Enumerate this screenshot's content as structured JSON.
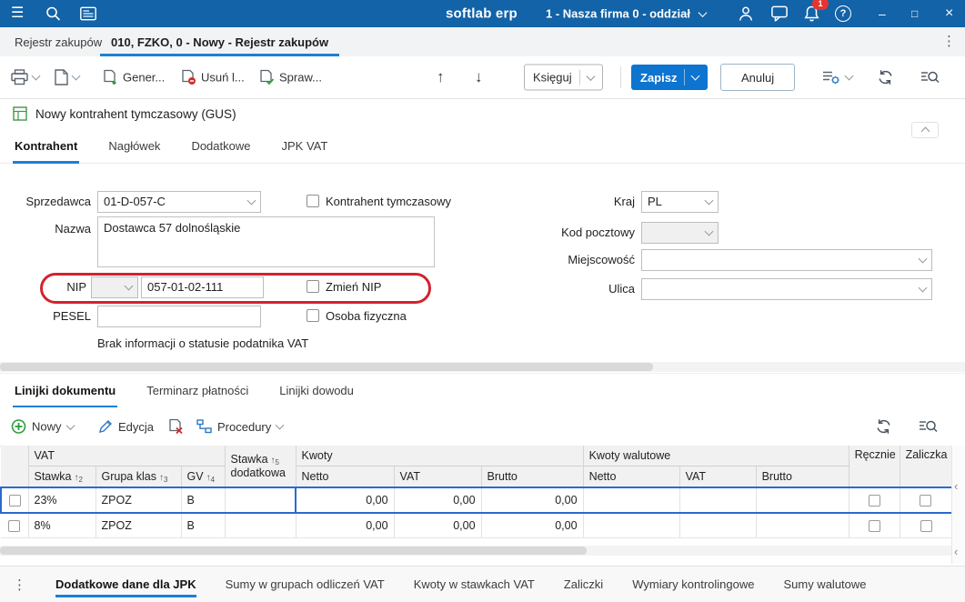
{
  "icons": {
    "hamburger": "☰",
    "dots_vertical": "⋮",
    "minimize": "–",
    "maximize": "□",
    "close": "×",
    "arrow_up": "↑",
    "arrow_down": "↓",
    "sort_asc": "↑",
    "chevron_left": "‹",
    "question": "?"
  },
  "topbar": {
    "brand": "softlab erp",
    "company": "1 - Nasza firma 0 - oddział",
    "notification_badge": "1"
  },
  "tabstrip": {
    "background_tab": "Rejestr zakupów",
    "active_tab": "010, FZKO, 0 - Nowy - Rejestr zakupów"
  },
  "toolbar": {
    "generate": "Gener...",
    "delete": "Usuń l...",
    "check": "Spraw...",
    "ksieguj": "Księguj",
    "zapisz": "Zapisz",
    "anuluj": "Anuluj"
  },
  "panel": {
    "title": "Nowy kontrahent tymczasowy (GUS)"
  },
  "form_tabs": {
    "kontrahent": "Kontrahent",
    "naglowek": "Nagłówek",
    "dodatkowe": "Dodatkowe",
    "jpk_vat": "JPK VAT"
  },
  "form": {
    "sprzedawca": {
      "label": "Sprzedawca",
      "value": "01-D-057-C"
    },
    "kontrahent_tymczasowy": "Kontrahent tymczasowy",
    "kraj": {
      "label": "Kraj",
      "value": "PL"
    },
    "nazwa": {
      "label": "Nazwa",
      "value": "Dostawca 57 dolnośląskie"
    },
    "kod_pocztowy": {
      "label": "Kod pocztowy",
      "value": ""
    },
    "miejscowosc": {
      "label": "Miejscowość",
      "value": ""
    },
    "nip": {
      "label": "NIP",
      "value": "057-01-02-111"
    },
    "zmien_nip": "Zmień NIP",
    "ulica": {
      "label": "Ulica",
      "value": ""
    },
    "pesel": {
      "label": "PESEL",
      "value": ""
    },
    "osoba_fizyczna": "Osoba fizyczna",
    "vat_status": "Brak informacji o statusie podatnika VAT"
  },
  "detail_tabs": {
    "linijki_dokumentu": "Linijki dokumentu",
    "terminarz": "Terminarz płatności",
    "linijki_dowodu": "Linijki dowodu"
  },
  "detail_toolbar": {
    "nowy": "Nowy",
    "edycja": "Edycja",
    "procedury": "Procedury"
  },
  "grid": {
    "groups": {
      "vat": "VAT",
      "kwoty": "Kwoty",
      "kwoty_walutowe": "Kwoty walutowe"
    },
    "columns": {
      "stawka": {
        "label": "Stawka",
        "sort": "2"
      },
      "grupa": {
        "label": "Grupa klas",
        "sort": "3"
      },
      "gv": {
        "label": "GV",
        "sort": "4"
      },
      "stawka_dodatkowa": {
        "label_top": "Stawka",
        "sort": "5",
        "label_bottom": "dodatkowa"
      },
      "netto": "Netto",
      "vat": "VAT",
      "brutto": "Brutto",
      "netto_wal": "Netto",
      "vat_wal": "VAT",
      "brutto_wal": "Brutto",
      "recznie": "Ręcznie",
      "zaliczka": "Zaliczka"
    },
    "rows": [
      {
        "stawka": "23%",
        "grupa": "ZPOZ",
        "gv": "B",
        "stawka_dodatkowa": "",
        "netto": "0,00",
        "vat": "0,00",
        "brutto": "0,00",
        "netto_wal": "",
        "vat_wal": "",
        "brutto_wal": ""
      },
      {
        "stawka": "8%",
        "grupa": "ZPOZ",
        "gv": "B",
        "stawka_dodatkowa": "",
        "netto": "0,00",
        "vat": "0,00",
        "brutto": "0,00",
        "netto_wal": "",
        "vat_wal": "",
        "brutto_wal": ""
      }
    ]
  },
  "bottom_tabs": {
    "jpk": "Dodatkowe dane dla JPK",
    "sumy_grupy": "Sumy w grupach odliczeń VAT",
    "kwoty_stawki": "Kwoty w stawkach VAT",
    "zaliczki": "Zaliczki",
    "wymiary": "Wymiary kontrolingowe",
    "sumy_walutowe": "Sumy walutowe"
  }
}
